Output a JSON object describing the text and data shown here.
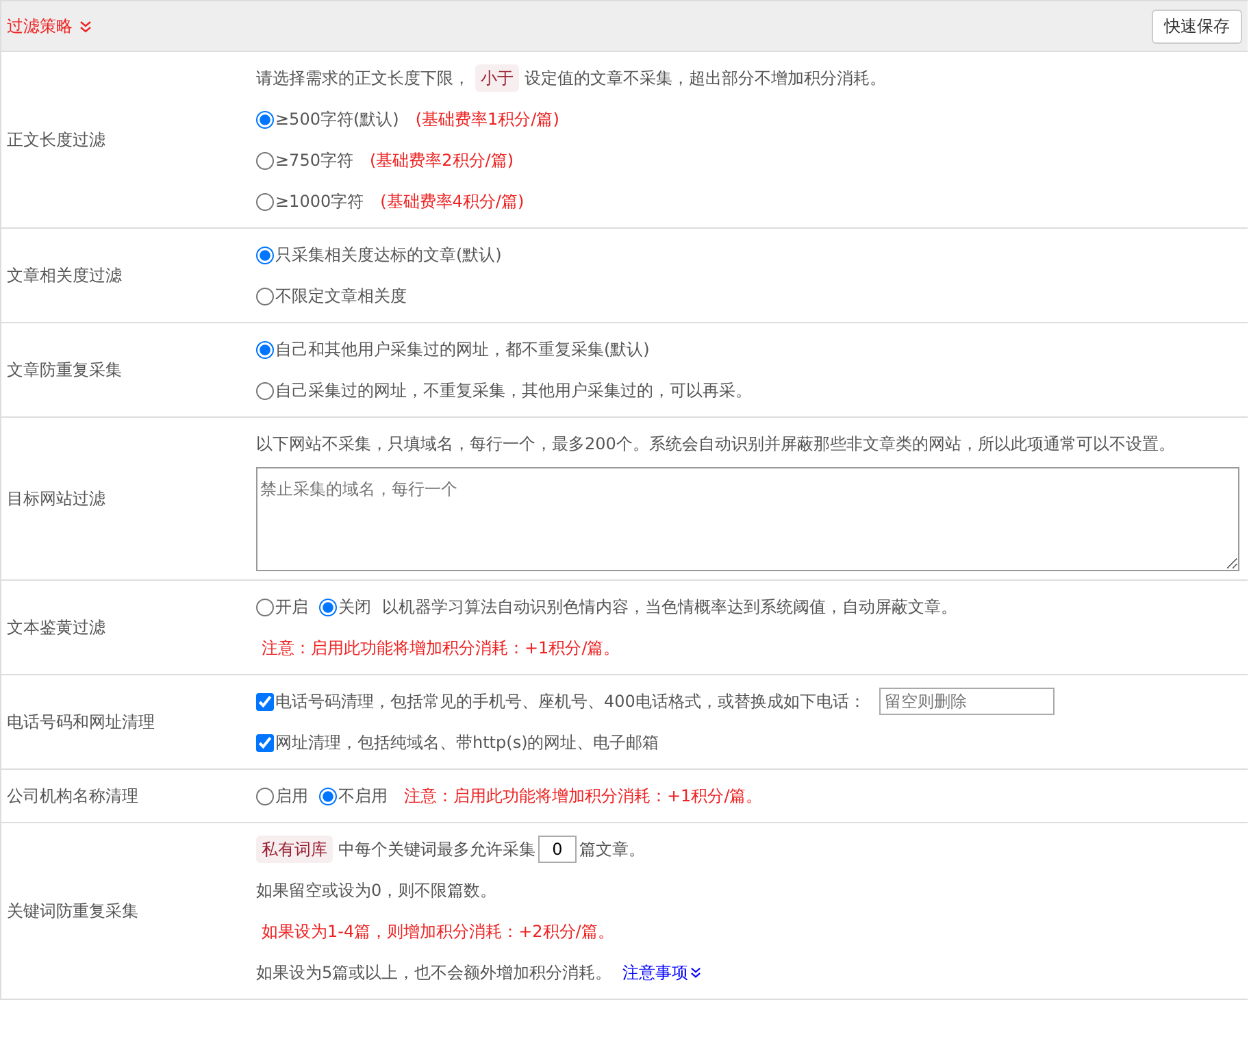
{
  "header": {
    "title": "过滤策略",
    "button": "快速保存"
  },
  "rows": [
    {
      "label": "正文长度过滤",
      "lines": [
        [
          {
            "kind": "text",
            "text": "请选择需求的正文长度下限，"
          },
          {
            "kind": "tag",
            "text": "小于"
          },
          {
            "kind": "text",
            "text": "设定值的文章不采集，超出部分不增加积分消耗。"
          }
        ],
        [
          {
            "kind": "radio",
            "text": "≥500字符(默认)",
            "selected": true
          },
          {
            "kind": "note",
            "text": "(基础费率1积分/篇)"
          }
        ],
        [
          {
            "kind": "radio",
            "text": "≥750字符",
            "selected": false
          },
          {
            "kind": "note",
            "text": "(基础费率2积分/篇)"
          }
        ],
        [
          {
            "kind": "radio",
            "text": "≥1000字符",
            "selected": false
          },
          {
            "kind": "note",
            "text": "(基础费率4积分/篇)"
          }
        ]
      ]
    },
    {
      "label": "文章相关度过滤",
      "lines": [
        [
          {
            "kind": "radio",
            "text": "只采集相关度达标的文章(默认)",
            "selected": true
          }
        ],
        [
          {
            "kind": "radio",
            "text": "不限定文章相关度",
            "selected": false
          }
        ]
      ]
    },
    {
      "label": "文章防重复采集",
      "lines": [
        [
          {
            "kind": "radio",
            "text": "自己和其他用户采集过的网址，都不重复采集(默认)",
            "selected": true
          }
        ],
        [
          {
            "kind": "radio",
            "text": "自己采集过的网址，不重复采集，其他用户采集过的，可以再采。",
            "selected": false
          }
        ]
      ]
    },
    {
      "label": "目标网站过滤",
      "lines": [
        [
          {
            "kind": "text",
            "text": "以下网站不采集，只填域名，每行一个，最多200个。系统会自动识别并屏蔽那些非文章类的网站，所以此项通常可以不设置。"
          }
        ],
        [
          {
            "kind": "area",
            "placeholder": "禁止采集的域名，每行一个"
          }
        ]
      ]
    },
    {
      "label": "文本鉴黄过滤",
      "lines": [
        [
          {
            "kind": "radio",
            "text": "开启",
            "selected": false
          },
          {
            "kind": "radio",
            "text": "关闭",
            "selected": true
          },
          {
            "kind": "text",
            "text": "以机器学习算法自动识别色情内容，当色情概率达到系统阈值，自动屏蔽文章。"
          }
        ],
        [
          {
            "kind": "note",
            "text": "注意：启用此功能将增加积分消耗：+1积分/篇。"
          }
        ]
      ]
    },
    {
      "label": "电话号码和网址清理",
      "lines": [
        [
          {
            "kind": "check",
            "text": "电话号码清理，包括常见的手机号、座机号、400电话格式，或替换成如下电话：",
            "checked": true
          },
          {
            "kind": "field",
            "placeholder": "留空则删除"
          }
        ],
        [
          {
            "kind": "check",
            "text": "网址清理，包括纯域名、带http(s)的网址、电子邮箱",
            "checked": true
          }
        ]
      ]
    },
    {
      "label": "公司机构名称清理",
      "lines": [
        [
          {
            "kind": "radio",
            "text": "启用",
            "selected": false
          },
          {
            "kind": "radio",
            "text": "不启用",
            "selected": true
          },
          {
            "kind": "note",
            "text": "注意：启用此功能将增加积分消耗：+1积分/篇。"
          }
        ]
      ]
    },
    {
      "label": "关键词防重复采集",
      "lines": [
        [
          {
            "kind": "tag",
            "text": "私有词库"
          },
          {
            "kind": "text",
            "text": "中每个关键词最多允许采集"
          },
          {
            "kind": "num",
            "value": "0"
          },
          {
            "kind": "text",
            "text": "篇文章。"
          }
        ],
        [
          {
            "kind": "text",
            "text": "如果留空或设为0，则不限篇数。"
          }
        ],
        [
          {
            "kind": "note",
            "text": "如果设为1-4篇，则增加积分消耗：+2积分/篇。"
          }
        ],
        [
          {
            "kind": "text",
            "text": "如果设为5篇或以上，也不会额外增加积分消耗。"
          },
          {
            "kind": "link",
            "text": "注意事项"
          }
        ]
      ]
    }
  ]
}
